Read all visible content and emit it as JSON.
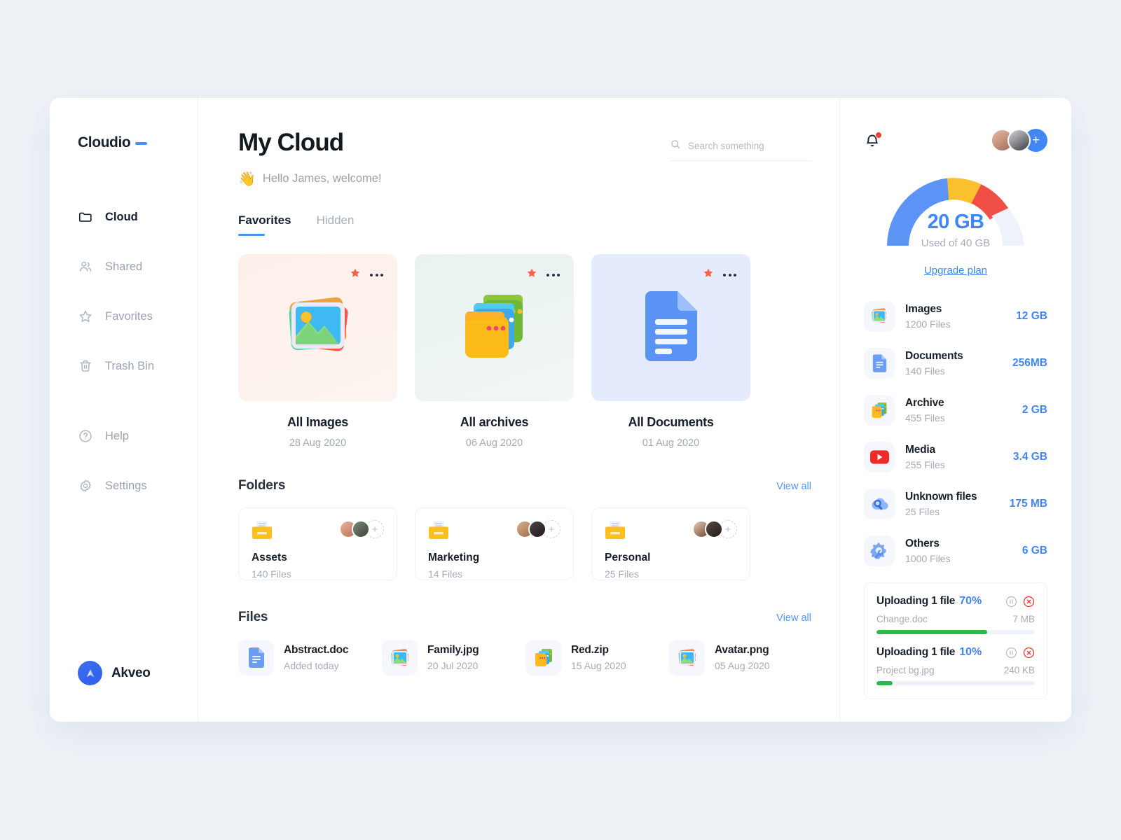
{
  "brand": {
    "name": "Cloudio"
  },
  "sidebar": {
    "items": [
      {
        "label": "Cloud",
        "icon": "folder-icon",
        "active": true
      },
      {
        "label": "Shared",
        "icon": "people-icon",
        "active": false
      },
      {
        "label": "Favorites",
        "icon": "star-outline-icon",
        "active": false
      },
      {
        "label": "Trash Bin",
        "icon": "trash-icon",
        "active": false
      }
    ],
    "items2": [
      {
        "label": "Help",
        "icon": "question-circle-icon"
      },
      {
        "label": "Settings",
        "icon": "gear-icon"
      }
    ],
    "footer": {
      "label": "Akveo"
    }
  },
  "header": {
    "title": "My Cloud",
    "greeting": "Hello James, welcome!",
    "wave_emoji": "👋"
  },
  "search": {
    "placeholder": "Search something",
    "value": ""
  },
  "tabs": [
    {
      "label": "Favorites",
      "active": true
    },
    {
      "label": "Hidden",
      "active": false
    }
  ],
  "cards": [
    {
      "title": "All Images",
      "date": "28 Aug 2020",
      "icon": "images-stack-icon",
      "favorite": true
    },
    {
      "title": "All archives",
      "date": "06 Aug 2020",
      "icon": "folders-stack-icon",
      "favorite": true
    },
    {
      "title": "All Documents",
      "date": "01 Aug 2020",
      "icon": "document-icon",
      "favorite": true
    }
  ],
  "folders_section": {
    "title": "Folders",
    "view_all": "View all",
    "items": [
      {
        "name": "Assets",
        "count": "140 Files"
      },
      {
        "name": "Marketing",
        "count": "14 Files"
      },
      {
        "name": "Personal",
        "count": "25 Files"
      }
    ]
  },
  "files_section": {
    "title": "Files",
    "view_all": "View all",
    "items": [
      {
        "name": "Abstract.doc",
        "date": "Added today",
        "icon": "document-icon"
      },
      {
        "name": "Family.jpg",
        "date": "20 Jul 2020",
        "icon": "image-icon"
      },
      {
        "name": "Red.zip",
        "date": "15 Aug 2020",
        "icon": "archive-icon"
      },
      {
        "name": "Avatar.png",
        "date": "05 Aug 2020",
        "icon": "image-icon"
      }
    ]
  },
  "storage": {
    "used_label": "20 GB",
    "capacity_label": "Used of 40 GB",
    "upgrade_label": "Upgrade plan",
    "gauge": {
      "segments": [
        {
          "name": "used-blue",
          "color": "#5b94f5",
          "sweep_deg": 97
        },
        {
          "name": "warn-yellow",
          "color": "#fbc02d",
          "sweep_deg": 30
        },
        {
          "name": "alert-red",
          "color": "#ef4f45",
          "sweep_deg": 30
        },
        {
          "name": "free-track",
          "color": "#eef2fb",
          "sweep_deg": 23
        }
      ]
    },
    "rows": [
      {
        "name": "Images",
        "count": "1200 Files",
        "size": "12 GB",
        "icon": "image-icon"
      },
      {
        "name": "Documents",
        "count": "140 Files",
        "size": "256MB",
        "icon": "document-icon"
      },
      {
        "name": "Archive",
        "count": "455 Files",
        "size": "2 GB",
        "icon": "archive-icon"
      },
      {
        "name": "Media",
        "count": "255 Files",
        "size": "3.4 GB",
        "icon": "play-icon"
      },
      {
        "name": "Unknown files",
        "count": "25 Files",
        "size": "175 MB",
        "icon": "search-cloud-icon"
      },
      {
        "name": "Others",
        "count": "1000 Files",
        "size": "6 GB",
        "icon": "gear-wrench-icon"
      }
    ]
  },
  "uploads": [
    {
      "title": "Uploading 1 file",
      "percent": "70%",
      "file": "Change.doc",
      "size": "7 MB",
      "progress": 70
    },
    {
      "title": "Uploading 1 file",
      "percent": "10%",
      "file": "Project bg.jpg",
      "size": "240 KB",
      "progress": 10
    }
  ],
  "colors": {
    "accent": "#4285f4",
    "accent_soft": "#5b94f5",
    "favorite_star": "#f4654a",
    "progress_green": "#2db84d",
    "danger": "#f0402f",
    "page_bg": "#eef2f7"
  }
}
